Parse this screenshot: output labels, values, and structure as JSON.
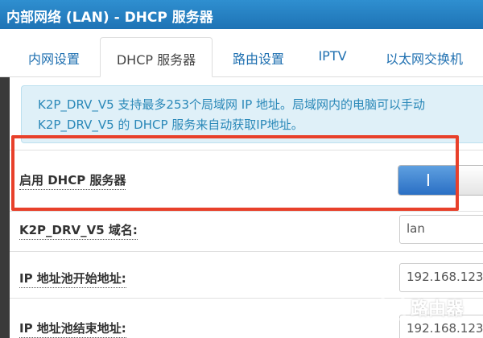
{
  "window": {
    "title": "内部网络 (LAN) - DHCP 服务器"
  },
  "tabs": [
    {
      "label": "内网设置",
      "active": false
    },
    {
      "label": "DHCP 服务器",
      "active": true
    },
    {
      "label": "路由设置",
      "active": false
    },
    {
      "label": "IPTV",
      "active": false
    },
    {
      "label": "以太网交换机",
      "active": false
    }
  ],
  "info": {
    "line1": "K2P_DRV_V5 支持最多253个局域网 IP 地址。局域网内的电脑可以手动",
    "line2": "K2P_DRV_V5 的 DHCP 服务来自动获取IP地址。"
  },
  "form": {
    "dhcp_enable": {
      "label": "启用 DHCP 服务器",
      "toggle_on_symbol": "I",
      "enabled": true
    },
    "domain": {
      "label": "K2P_DRV_V5 域名:",
      "value": "lan"
    },
    "pool_start": {
      "label": "IP 地址池开始地址:",
      "value": "192.168.123"
    },
    "pool_end": {
      "label": "IP 地址池结束地址:",
      "value": "192.168.123"
    }
  },
  "watermark": {
    "text": "路由器"
  },
  "colors": {
    "title_bar": "#1e73b5",
    "tab_link": "#1e6fb0",
    "info_bg": "#dff0f8",
    "info_text": "#2a88b8",
    "toggle_on": "#2a6fc4",
    "highlight": "#e8402a"
  }
}
